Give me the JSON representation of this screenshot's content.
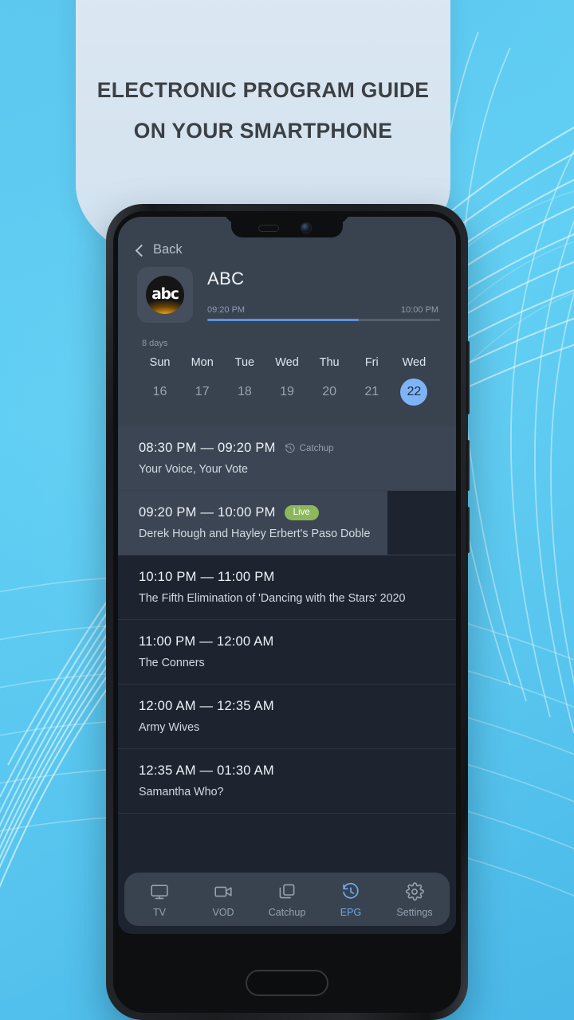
{
  "promo": {
    "headline_line1": "ELECTRONIC PROGRAM GUIDE",
    "headline_line2": "ON YOUR SMARTPHONE",
    "headline_color": "#3b4044",
    "background_color": "#5ec8f0"
  },
  "app": {
    "nav_back": {
      "label": "Back",
      "icon": "chevron-left-icon"
    },
    "channel": {
      "name": "ABC",
      "logo_text": "abc",
      "logo_icon": "abc-channel-logo"
    },
    "now_playing": {
      "start_time": "09:20 PM",
      "end_time": "10:00 PM",
      "progress_percent": 65,
      "progress_color": "#5b94e0"
    },
    "date_picker": {
      "range_label": "8 days",
      "selected_index": 6,
      "accent_color": "#7eb4f7",
      "days": [
        {
          "dow": "Sun",
          "num": "16"
        },
        {
          "dow": "Mon",
          "num": "17"
        },
        {
          "dow": "Tue",
          "num": "18"
        },
        {
          "dow": "Wed",
          "num": "19"
        },
        {
          "dow": "Thu",
          "num": "20"
        },
        {
          "dow": "Fri",
          "num": "21"
        },
        {
          "dow": "Wed",
          "num": "22"
        }
      ]
    },
    "programs": [
      {
        "time": "08:30 PM — 09:20 PM",
        "title": "Your Voice, Your Vote",
        "tag": "Catchup",
        "tag_type": "catchup",
        "tag_icon": "clock-rewind-icon",
        "highlighted": true,
        "has_thumb": false
      },
      {
        "time": "09:20 PM — 10:00 PM",
        "title": "Derek Hough and Hayley Erbert's Paso Doble",
        "tag": "Live",
        "tag_type": "live",
        "tag_color": "#8cb85b",
        "highlighted": true,
        "has_thumb": true
      },
      {
        "time": "10:10 PM — 11:00 PM",
        "title": "The Fifth Elimination of 'Dancing with the Stars' 2020",
        "tag": "",
        "tag_type": "none",
        "highlighted": false,
        "has_thumb": false
      },
      {
        "time": "11:00 PM — 12:00 AM",
        "title": "The Conners",
        "tag": "",
        "tag_type": "none",
        "highlighted": false,
        "has_thumb": false
      },
      {
        "time": "12:00 AM — 12:35 AM",
        "title": "Army Wives",
        "tag": "",
        "tag_type": "none",
        "highlighted": false,
        "has_thumb": false
      },
      {
        "time": "12:35 AM — 01:30 AM",
        "title": "Samantha Who?",
        "tag": "",
        "tag_type": "none",
        "highlighted": false,
        "has_thumb": false
      }
    ],
    "bottom_nav": {
      "active_index": 3,
      "active_color": "#6fa8f0",
      "items": [
        {
          "label": "TV",
          "icon": "tv-monitor-icon"
        },
        {
          "label": "VOD",
          "icon": "video-camera-icon"
        },
        {
          "label": "Catchup",
          "icon": "stacked-squares-icon"
        },
        {
          "label": "EPG",
          "icon": "clock-rewind-icon"
        },
        {
          "label": "Settings",
          "icon": "gear-icon"
        }
      ]
    }
  }
}
